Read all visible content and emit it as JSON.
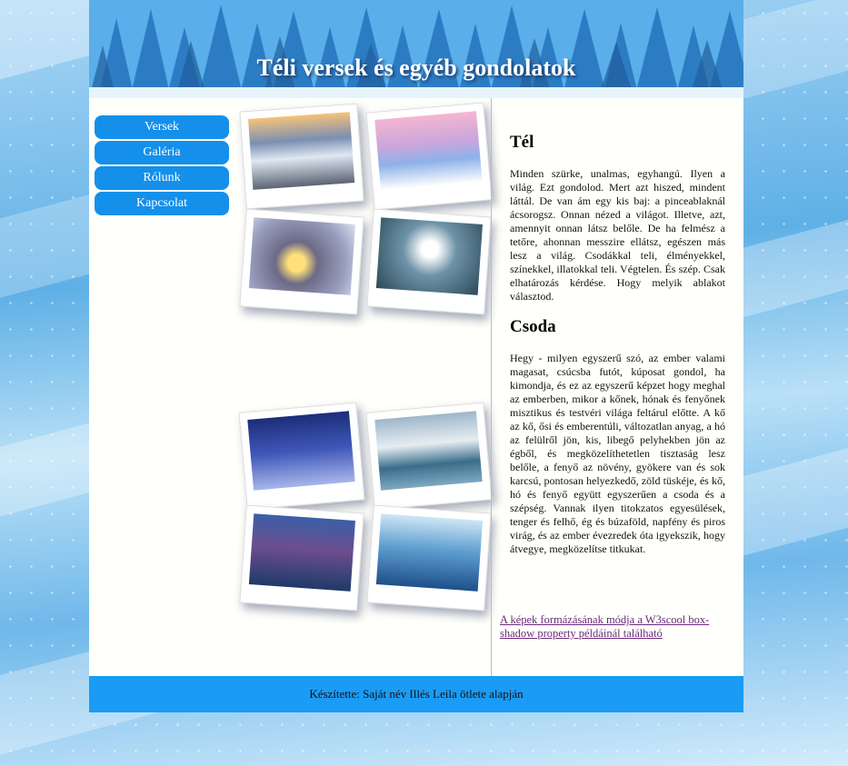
{
  "header": {
    "title": "Téli versek és egyéb gondolatok"
  },
  "nav": {
    "items": [
      "Versek",
      "Galéria",
      "Rólunk",
      "Kapcsolat"
    ]
  },
  "gallery": {
    "photos": [
      "winter-road-sunset",
      "snowy-castle-lake",
      "snow-lantern",
      "woman-throwing-snow",
      "blue-winter-forest",
      "hallstatt-winter-lake",
      "people-by-river",
      "frozen-river"
    ]
  },
  "content": {
    "section1": {
      "heading": "Tél",
      "text": "Minden szürke, unalmas, egyhangú. Ilyen a világ. Ezt gondolod. Mert azt hiszed, mindent láttál. De van ám egy kis baj: a pinceablaknál ácsorogsz. Onnan nézed a világot. Illetve, azt, amennyit onnan látsz belőle. De ha felmész a tetőre, ahonnan messzire ellátsz, egészen más lesz a világ. Csodákkal teli, élményekkel, színekkel, illatokkal teli. Végtelen. És szép. Csak elhatározás kérdése. Hogy melyik ablakot választod."
    },
    "section2": {
      "heading": "Csoda",
      "text": "Hegy - milyen egyszerű szó, az ember valami magasat, csúcsba futót, kúposat gondol, ha kimondja, és ez az egyszerű képzet hogy meghal az emberben, mikor a kőnek, hónak és fenyőnek misztikus és testvéri világa feltárul előtte. A kő az kő, ősi és emberentúli, változatlan anyag, a hó az felülről jön, kis, libegő pelyhekben jön az égből, és megközelíthetetlen tisztaság lesz belőle, a fenyő az növény, gyökere van és sok karcsú, pontosan helyezkedő, zöld tüskéje, és kő, hó és fenyő együtt egyszerűen a csoda és a szépség. Vannak ilyen titokzatos egyesülések, tenger és felhő, ég és búzaföld, napfény és piros virág, és az ember évezredek óta igyekszik, hogy átvegye, megközelítse titkukat."
    },
    "source_link": "A képek formázásának módja a W3scool box-shadow property példáinál található"
  },
  "footer": {
    "text": "Készítette: Saját név Illés Leila ötlete alapján"
  },
  "colors": {
    "nav_button": "#1490ea",
    "footer": "#1a9bf6",
    "link": "#6b2a7a"
  }
}
